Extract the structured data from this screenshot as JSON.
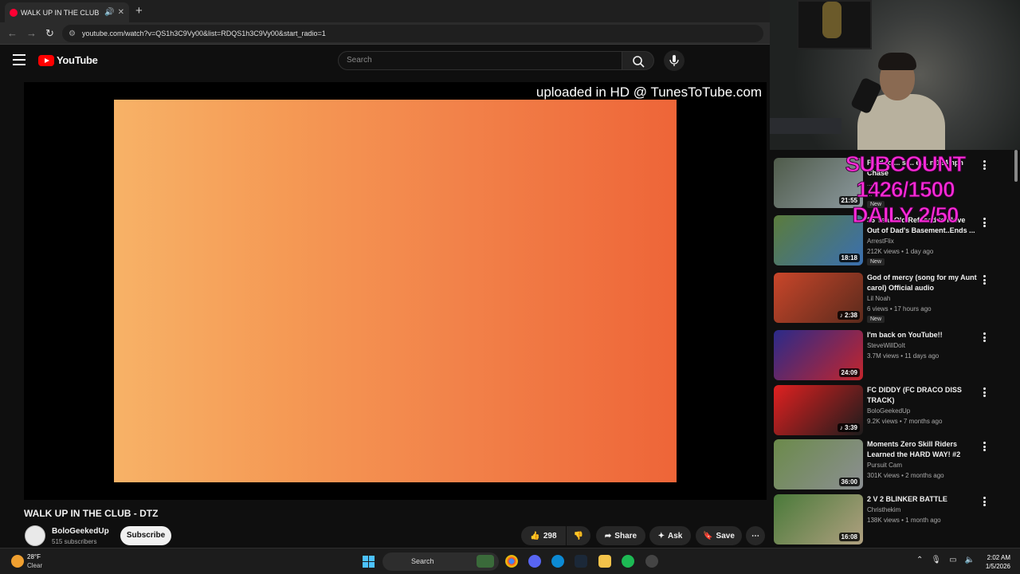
{
  "browser": {
    "tab_title": "WALK UP IN THE CLUB - DT",
    "new_tab": "+",
    "url": "youtube.com/watch?v=QS1h3C9Vy00&list=RDQS1h3C9Vy00&start_radio=1"
  },
  "header": {
    "logo": "YouTube",
    "search_placeholder": "Search"
  },
  "video": {
    "watermark": "uploaded in HD @ TunesToTube.com",
    "title": "WALK UP IN THE CLUB - DTZ",
    "channel": "BoloGeekedUp",
    "subscribers": "515 subscribers",
    "subscribe_label": "Subscribe",
    "likes": "298",
    "share_label": "Share",
    "ask_label": "Ask",
    "save_label": "Save"
  },
  "overlay": {
    "subcount": "SUBCOUNT 1426/1500",
    "daily": "DAILY 2/50"
  },
  "sidebar": {
    "items": [
      {
        "title": "P... d to ... s ... e ... n 124mph Chase",
        "channel": "...",
        "meta": "...",
        "badge": "New",
        "duration": "21:55",
        "colors": [
          "#4f5b4a",
          "#8d9aa0"
        ]
      },
      {
        "title": "36 Year Old Refused to Move Out of Dad's Basement..Ends ...",
        "channel": "ArrestFlix",
        "meta": "212K views • 1 day ago",
        "badge": "New",
        "duration": "18:18",
        "colors": [
          "#5b7c3c",
          "#3a6fb0"
        ]
      },
      {
        "title": "God of mercy (song for my Aunt carol) Official audio",
        "channel": "Lil Noah",
        "meta": "6 views • 17 hours ago",
        "badge": "New",
        "duration": "♪ 2:38",
        "colors": [
          "#c9462a",
          "#5a2a1c"
        ]
      },
      {
        "title": "I'm back on YouTube!!",
        "channel": "SteveWillDoIt",
        "meta": "3.7M views • 11 days ago",
        "badge": "",
        "duration": "24:09",
        "colors": [
          "#2a2a8a",
          "#c4252c"
        ]
      },
      {
        "title": "FC DIDDY (FC DRACO DISS TRACK)",
        "channel": "BoloGeekedUp",
        "meta": "9.2K views • 7 months ago",
        "badge": "",
        "duration": "♪ 3:39",
        "colors": [
          "#e02020",
          "#1c1c1c"
        ]
      },
      {
        "title": "Moments Zero Skill Riders Learned the HARD WAY! #2",
        "channel": "Pursuit Cam",
        "meta": "301K views • 2 months ago",
        "badge": "",
        "duration": "36:00",
        "colors": [
          "#6b8a4a",
          "#8c8f93"
        ]
      },
      {
        "title": "2 V 2 BLINKER BATTLE",
        "channel": "Christhekim",
        "meta": "138K views • 1 month ago",
        "badge": "",
        "duration": "16:08",
        "colors": [
          "#4a7a3a",
          "#b0a080"
        ]
      }
    ]
  },
  "taskbar": {
    "temp": "28°F",
    "condition": "Clear",
    "search": "Search",
    "time": "2:02 AM",
    "date": "1/5/2026"
  }
}
